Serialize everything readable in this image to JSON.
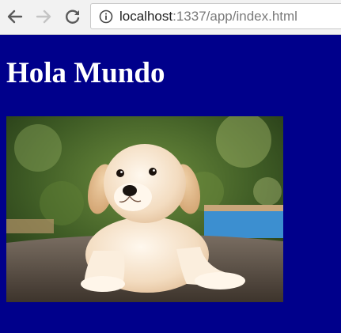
{
  "browser": {
    "url_host": "localhost",
    "url_path": ":1337/app/index.html"
  },
  "page": {
    "heading": "Hola Mundo",
    "background": "#00008b",
    "image": "puppy photo"
  },
  "icons": {
    "back": "back-arrow-icon",
    "forward": "forward-arrow-icon",
    "reload": "reload-icon",
    "info": "info-icon"
  }
}
